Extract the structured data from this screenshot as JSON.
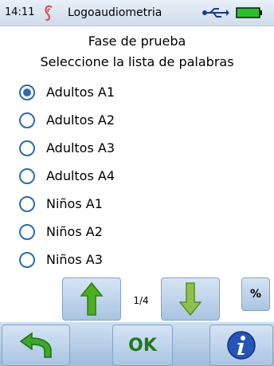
{
  "status": {
    "time": "14:11",
    "title": "Logoaudiometria",
    "icons": [
      "ear-icon",
      "usb-icon",
      "battery-icon"
    ]
  },
  "heading": {
    "line1": "Fase de prueba",
    "line2": "Seleccione la lista de palabras"
  },
  "options": [
    {
      "label": "Adultos A1",
      "checked": true
    },
    {
      "label": "Adultos A2",
      "checked": false
    },
    {
      "label": "Adultos A3",
      "checked": false
    },
    {
      "label": "Adultos A4",
      "checked": false
    },
    {
      "label": "Niños A1",
      "checked": false
    },
    {
      "label": "Niños A2",
      "checked": false
    },
    {
      "label": "Niños A3",
      "checked": false
    }
  ],
  "pager": {
    "indicator": "1/4",
    "percent_label": "%"
  },
  "bottom": {
    "ok_label": "OK"
  },
  "colors": {
    "accent": "#2b6bb5",
    "ok_green": "#1f7a1a",
    "arrow_green": "#4caf1f"
  }
}
